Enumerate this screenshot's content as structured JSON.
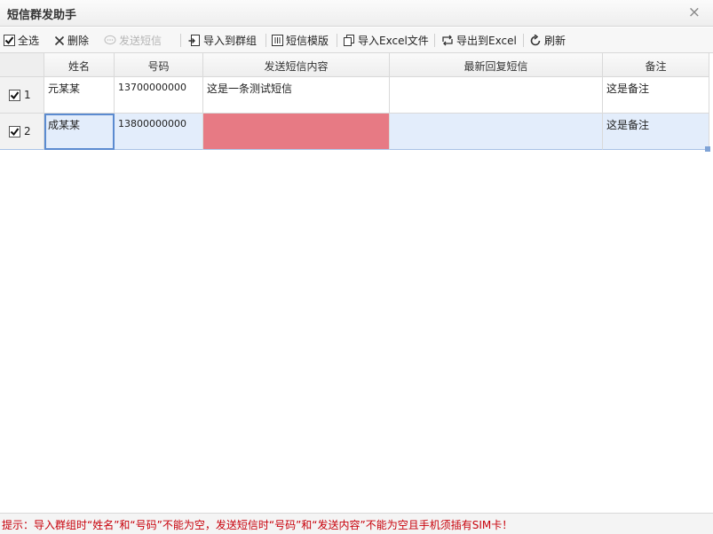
{
  "window": {
    "title": "短信群发助手",
    "close_label": "×"
  },
  "toolbar": {
    "select_all": "全选",
    "delete": "删除",
    "send_sms": "发送短信",
    "import_group": "导入到群组",
    "sms_template": "短信模版",
    "import_excel": "导入Excel文件",
    "export_excel": "导出到Excel",
    "refresh": "刷新"
  },
  "table": {
    "columns": [
      "姓名",
      "号码",
      "发送短信内容",
      "最新回复短信",
      "备注"
    ],
    "rows": [
      {
        "index": "1",
        "checked": true,
        "name": "元某某",
        "phone": "13700000000",
        "content": "这是一条测试短信",
        "reply": "",
        "note": "这是备注"
      },
      {
        "index": "2",
        "checked": true,
        "name": "成某某",
        "phone": "13800000000",
        "content": "",
        "reply": "",
        "note": "这是备注"
      }
    ]
  },
  "status": {
    "hint": "提示：导入群组时“姓名”和“号码”不能为空，发送短信时“号码”和“发送内容”不能为空且手机须插有SIM卡！"
  },
  "colors": {
    "error_cell": "#e77a84",
    "selected_row": "#e3edfb",
    "hint_text": "#c8000a"
  }
}
